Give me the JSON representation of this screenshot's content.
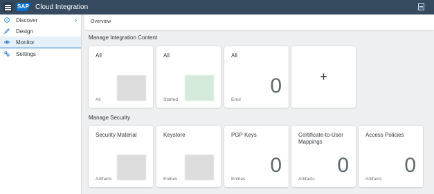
{
  "shell": {
    "logo": "SAP",
    "title": "Cloud Integration"
  },
  "nav": [
    {
      "label": "Discover",
      "icon": "compass-icon"
    },
    {
      "label": "Design",
      "icon": "pencil-icon"
    },
    {
      "label": "Monitor",
      "icon": "eye-icon"
    },
    {
      "label": "Settings",
      "icon": "settings-icon"
    }
  ],
  "breadcrumb": "Overview",
  "sections": {
    "integration": {
      "title": "Manage Integration Content"
    },
    "security": {
      "title": "Manage Security"
    }
  },
  "integration_tiles": [
    {
      "title": "All",
      "footer": "All"
    },
    {
      "title": "All",
      "footer": "Started"
    },
    {
      "title": "All",
      "footer": "Error",
      "count": "0"
    },
    {
      "plus": "+"
    }
  ],
  "security_tiles": [
    {
      "title": "Security Material",
      "footer": "Artifacts"
    },
    {
      "title": "Keystore",
      "footer": "Entries"
    },
    {
      "title": "PGP Keys",
      "footer": "Entries",
      "count": "0"
    },
    {
      "title": "Certificate-to-User Mappings",
      "footer": "Artifacts",
      "count": "0"
    },
    {
      "title": "Access Policies",
      "footer": "Artifacts",
      "count": "0"
    }
  ]
}
